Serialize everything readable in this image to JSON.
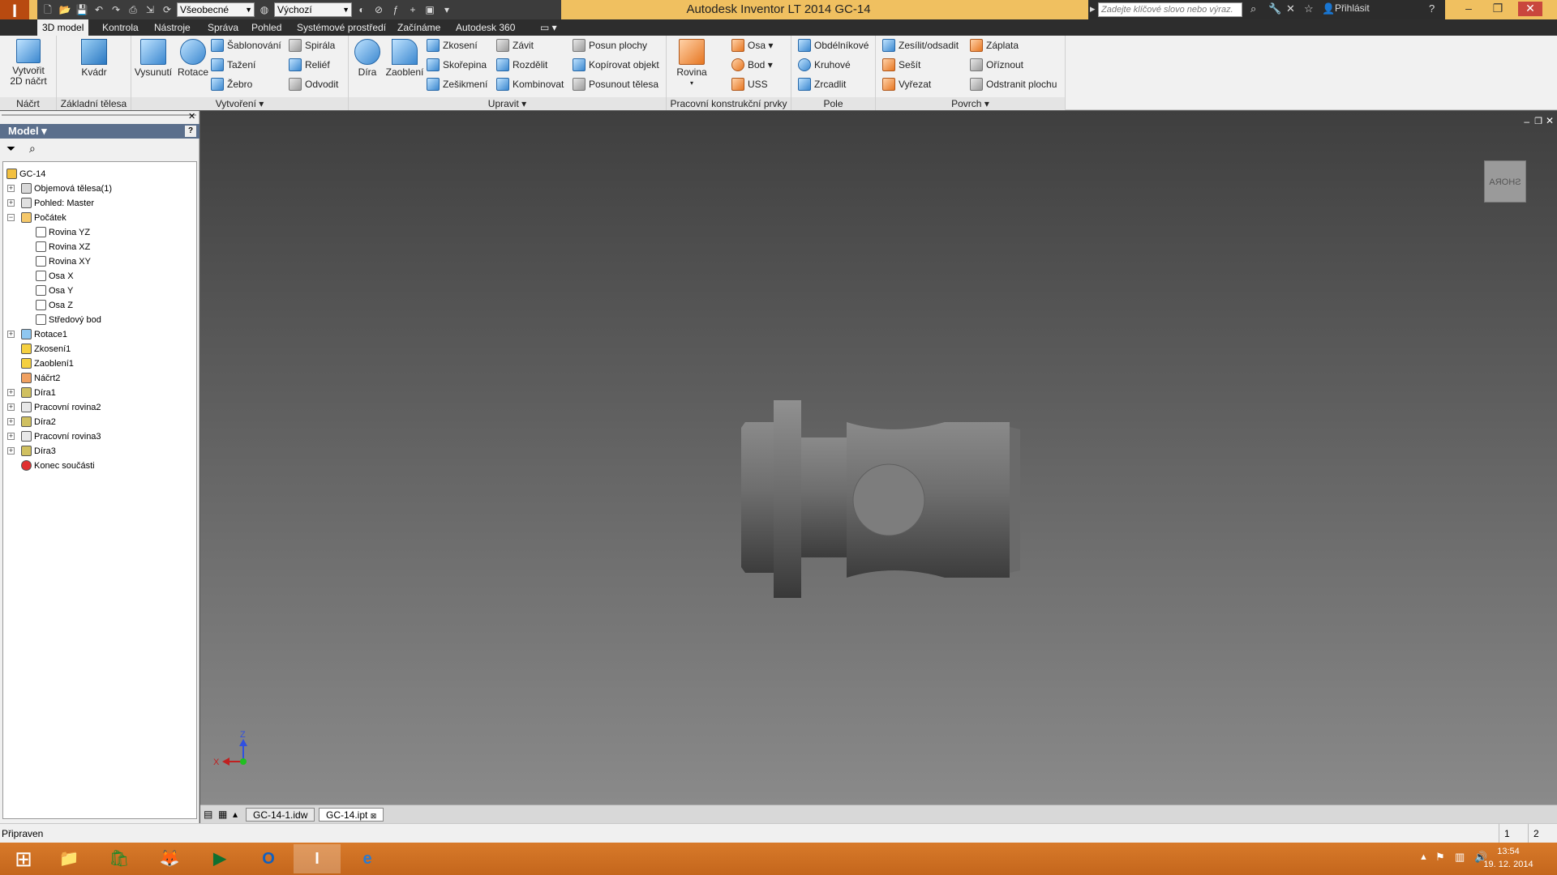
{
  "app": {
    "title": "Autodesk Inventor LT 2014    GC-14",
    "logo_letter": "I",
    "logo_sub": "LT"
  },
  "qat": {
    "style_select": "Všeobecné",
    "appearance_select": "Výchozí"
  },
  "search": {
    "placeholder": "Zadejte klíčové slovo nebo výraz."
  },
  "user": {
    "signin": "Přihlásit"
  },
  "menu_tabs": [
    "3D model",
    "Kontrola",
    "Nástroje",
    "Správa",
    "Pohled",
    "Systémové prostředí",
    "Začínáme",
    "Autodesk 360"
  ],
  "ribbon": {
    "nacrt": {
      "label": "Náčrt",
      "create_sketch": "Vytvořit\n2D náčrt"
    },
    "zakladni": {
      "label": "Základní tělesa",
      "kvadr": "Kvádr"
    },
    "vytvoreni": {
      "label": "Vytvoření",
      "vysunuti": "Vysunutí",
      "rotace": "Rotace",
      "sablonovani": "Šablonování",
      "tazeni": "Tažení",
      "zebro": "Žebro",
      "spirala": "Spirála",
      "relief": "Reliéf",
      "odvodit": "Odvodit"
    },
    "upravit": {
      "label": "Upravit",
      "dira": "Díra",
      "zaobleni": "Zaoblení",
      "zkoseni": "Zkosení",
      "skorepina": "Skořepina",
      "zesikmeni": "Zešikmení",
      "zavit": "Závit",
      "rozdelit": "Rozdělit",
      "kombinovat": "Kombinovat",
      "posun_plochy": "Posun plochy",
      "kopirovat": "Kopírovat objekt",
      "posunout": "Posunout tělesa"
    },
    "pracovni": {
      "label": "Pracovní konstrukční prvky",
      "rovina": "Rovina",
      "osa": "Osa",
      "bod": "Bod",
      "uss": "USS"
    },
    "pole": {
      "label": "Pole",
      "obdelnikove": "Obdélníkové",
      "kruhove": "Kruhové",
      "zrcadlit": "Zrcadlit"
    },
    "povrch": {
      "label": "Povrch",
      "zesilit": "Zesílit/odsadit",
      "sesit": "Sešít",
      "vyrezat": "Vyřezat",
      "zaplata": "Záplata",
      "oriznout": "Oříznout",
      "odstranit": "Odstranit plochu"
    }
  },
  "browser": {
    "title": "Model",
    "tree": [
      {
        "label": "GC-14",
        "indent": 0,
        "icon": "part-icon",
        "expand": false
      },
      {
        "label": "Objemová tělesa(1)",
        "indent": 1,
        "icon": "solid-bodies-icon",
        "expand": true
      },
      {
        "label": "Pohled: Master",
        "indent": 1,
        "icon": "view-rep-icon",
        "expand": true
      },
      {
        "label": "Počátek",
        "indent": 1,
        "icon": "origin-folder-icon",
        "expand": true
      },
      {
        "label": "Rovina YZ",
        "indent": 2,
        "icon": "plane-icon",
        "expand": false
      },
      {
        "label": "Rovina XZ",
        "indent": 2,
        "icon": "plane-icon",
        "expand": false
      },
      {
        "label": "Rovina XY",
        "indent": 2,
        "icon": "plane-icon",
        "expand": false
      },
      {
        "label": "Osa X",
        "indent": 2,
        "icon": "axis-icon",
        "expand": false
      },
      {
        "label": "Osa Y",
        "indent": 2,
        "icon": "axis-icon",
        "expand": false
      },
      {
        "label": "Osa Z",
        "indent": 2,
        "icon": "axis-icon",
        "expand": false
      },
      {
        "label": "Středový bod",
        "indent": 2,
        "icon": "point-icon",
        "expand": false
      },
      {
        "label": "Rotace1",
        "indent": 1,
        "icon": "revolve-icon",
        "expand": true
      },
      {
        "label": "Zkosení1",
        "indent": 1,
        "icon": "chamfer-icon",
        "expand": false
      },
      {
        "label": "Zaoblení1",
        "indent": 1,
        "icon": "fillet-icon",
        "expand": false
      },
      {
        "label": "Náčrt2",
        "indent": 1,
        "icon": "sketch-icon",
        "expand": false
      },
      {
        "label": "Díra1",
        "indent": 1,
        "icon": "hole-icon",
        "expand": true
      },
      {
        "label": "Pracovní rovina2",
        "indent": 1,
        "icon": "work-plane-icon",
        "expand": true
      },
      {
        "label": "Díra2",
        "indent": 1,
        "icon": "hole-icon",
        "expand": true
      },
      {
        "label": "Pracovní rovina3",
        "indent": 1,
        "icon": "work-plane-icon",
        "expand": true
      },
      {
        "label": "Díra3",
        "indent": 1,
        "icon": "hole-icon",
        "expand": true
      },
      {
        "label": "Konec součásti",
        "indent": 1,
        "icon": "end-of-part-icon",
        "expand": false
      }
    ]
  },
  "viewcube": {
    "label": "SHORA"
  },
  "triad": {
    "x": "X",
    "z": "Z"
  },
  "doc_tabs": [
    "GC-14-1.idw",
    "GC-14.ipt"
  ],
  "status": {
    "text": "Připraven",
    "count1": "1",
    "count2": "2"
  },
  "taskbar": {
    "time": "13:54",
    "date": "19. 12. 2014"
  },
  "colors": {
    "accent": "#f0c060",
    "taskbar": "#d27020",
    "browser_header": "#5b6f8c"
  }
}
